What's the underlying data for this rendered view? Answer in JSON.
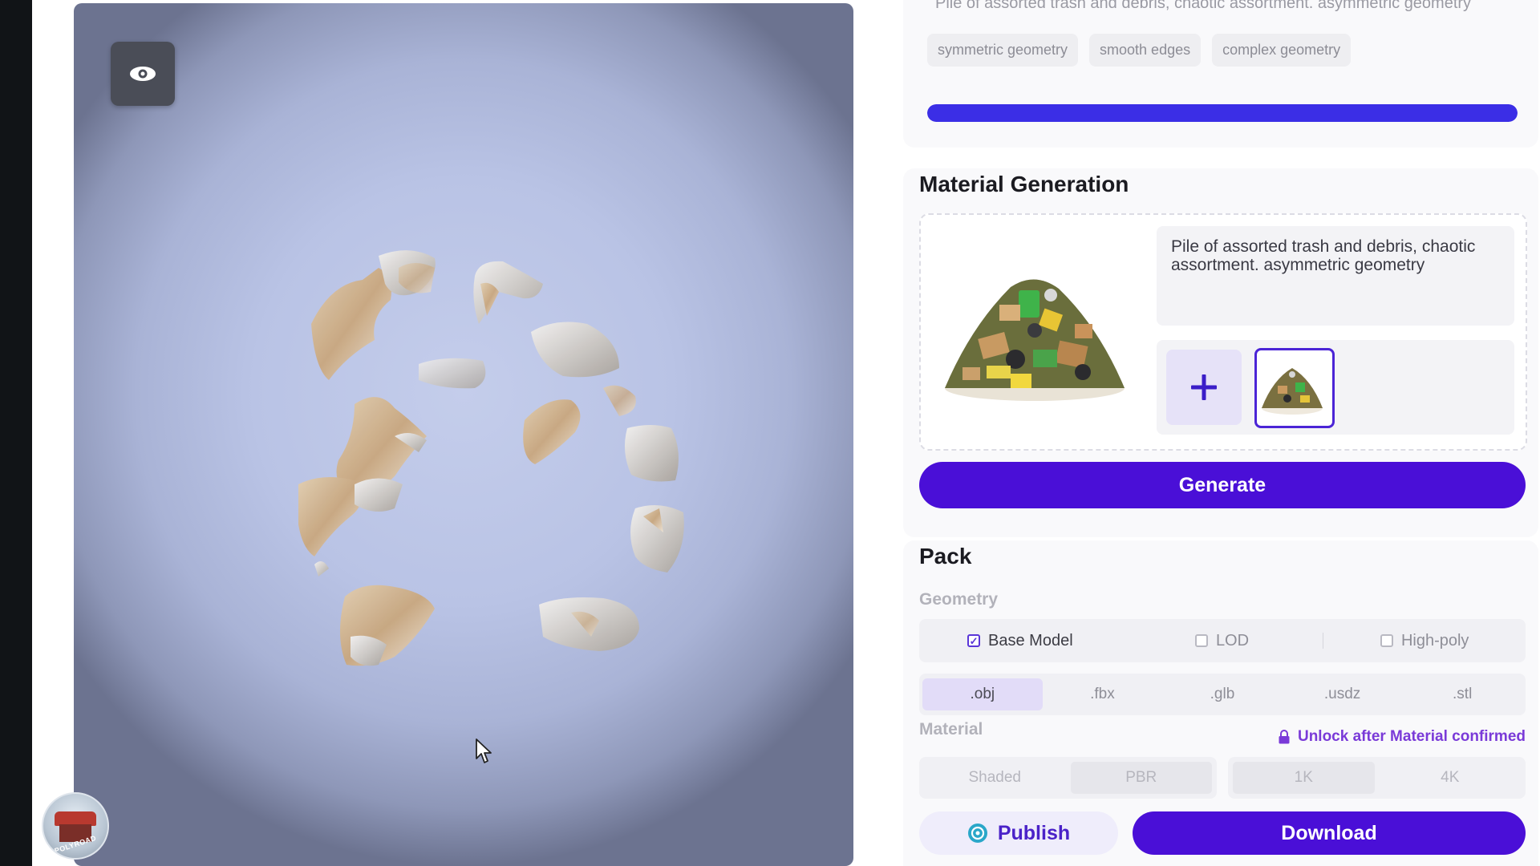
{
  "viewer": {
    "eye_icon": "eye-icon",
    "cursor_icon": "mouse-pointer-icon"
  },
  "avatar": {
    "text": "POLYROAD"
  },
  "top_card": {
    "prompt_partial": "Pile of assorted trash and debris, chaotic assortment. asymmetric geometry",
    "tags": [
      "symmetric geometry",
      "smooth edges",
      "complex geometry"
    ],
    "progress": 1.0,
    "progress_color": "#3b2ee6"
  },
  "material_generation": {
    "title": "Material Generation",
    "prompt": "Pile of assorted trash and debris, chaotic assortment. asymmetric geometry",
    "add_icon": "plus-icon",
    "generate_label": "Generate"
  },
  "pack": {
    "title": "Pack",
    "geometry_label": "Geometry",
    "geometry_options": [
      {
        "label": "Base Model",
        "checked": true
      },
      {
        "label": "LOD",
        "checked": false
      },
      {
        "label": "High-poly",
        "checked": false
      }
    ],
    "formats": [
      ".obj",
      ".fbx",
      ".glb",
      ".usdz",
      ".stl"
    ],
    "selected_format": ".obj",
    "material_label": "Material",
    "lock_icon": "lock-icon",
    "lock_text": "Unlock after Material confirmed",
    "material_types": [
      "Shaded",
      "PBR"
    ],
    "resolutions": [
      "1K",
      "4K"
    ],
    "publish_label": "Publish",
    "download_label": "Download"
  },
  "colors": {
    "accent": "#4a0fd7",
    "lock": "#7a3ad8"
  }
}
